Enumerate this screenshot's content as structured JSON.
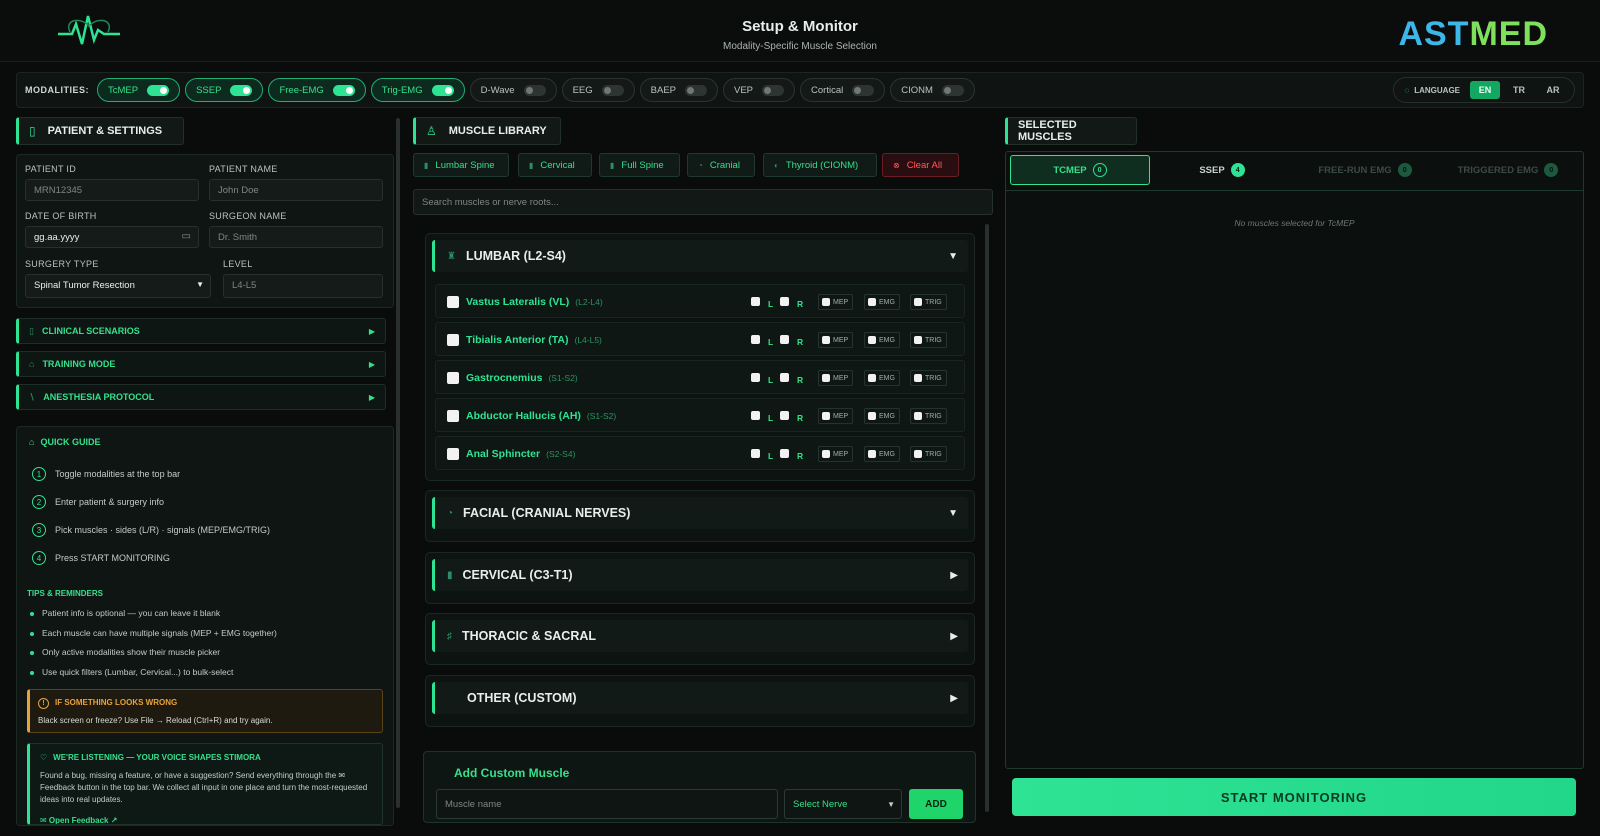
{
  "header": {
    "title": "Setup & Monitor",
    "subtitle": "Modality-Specific Muscle Selection",
    "brand_a": "AST",
    "brand_b": "MED"
  },
  "modalities": {
    "label": "MODALITIES:",
    "items": [
      {
        "label": "TcMEP",
        "on": true
      },
      {
        "label": "SSEP",
        "on": true
      },
      {
        "label": "Free-EMG",
        "on": true
      },
      {
        "label": "Trig-EMG",
        "on": true
      },
      {
        "label": "D-Wave",
        "on": false
      },
      {
        "label": "EEG",
        "on": false
      },
      {
        "label": "BAEP",
        "on": false
      },
      {
        "label": "VEP",
        "on": false
      },
      {
        "label": "Cortical",
        "on": false
      },
      {
        "label": "CIONM",
        "on": false
      }
    ]
  },
  "language": {
    "label": "LANGUAGE",
    "options": [
      "EN",
      "TR",
      "AR"
    ],
    "active": "EN"
  },
  "patient": {
    "title": "PATIENT & SETTINGS",
    "patient_id_label": "PATIENT ID",
    "patient_id_placeholder": "MRN12345",
    "patient_name_label": "PATIENT NAME",
    "patient_name_placeholder": "John Doe",
    "dob_label": "DATE OF BIRTH",
    "dob_value": "gg.aa.yyyy",
    "surgeon_label": "SURGEON NAME",
    "surgeon_placeholder": "Dr. Smith",
    "surgery_type_label": "SURGERY TYPE",
    "surgery_type_value": "Spinal Tumor Resection",
    "level_label": "LEVEL",
    "level_placeholder": "L4-L5"
  },
  "accordions": [
    "CLINICAL SCENARIOS",
    "TRAINING MODE",
    "ANESTHESIA PROTOCOL"
  ],
  "guide": {
    "title": "QUICK GUIDE",
    "steps": [
      "Toggle modalities at the top bar",
      "Enter patient & surgery info",
      "Pick muscles · sides (L/R) · signals (MEP/EMG/TRIG)",
      "Press START MONITORING"
    ],
    "tips_title": "TIPS & REMINDERS",
    "tips": [
      "Patient info is optional — you can leave it blank",
      "Each muscle can have multiple signals (MEP + EMG together)",
      "Only active modalities show their muscle picker",
      "Use quick filters (Lumbar, Cervical...) to bulk-select"
    ],
    "warn_title": "IF SOMETHING LOOKS WRONG",
    "warn_text": "Black screen or freeze? Use File → Reload (Ctrl+R) and try again.",
    "feedback_title": "WE'RE LISTENING — YOUR VOICE SHAPES STIMORA",
    "feedback_text": "Found a bug, missing a feature, or have a suggestion? Send everything through the ✉ Feedback button in the top bar. We collect all input in one place and turn the most-requested ideas into real updates.",
    "feedback_link": "✉ Open Feedback ↗"
  },
  "library": {
    "title": "MUSCLE LIBRARY",
    "filters": [
      "Lumbar Spine",
      "Cervical",
      "Full Spine",
      "Cranial",
      "Thyroid (CIONM)"
    ],
    "clear_label": "Clear All",
    "search_placeholder": "Search muscles or nerve roots...",
    "groups": [
      "LUMBAR (L2-S4)",
      "FACIAL (CRANIAL NERVES)",
      "CERVICAL (C3-T1)",
      "THORACIC & SACRAL",
      "OTHER (CUSTOM)"
    ],
    "muscles": [
      {
        "name": "Vastus Lateralis (VL)",
        "root": "(L2-L4)"
      },
      {
        "name": "Tibialis Anterior (TA)",
        "root": "(L4-L5)"
      },
      {
        "name": "Gastrocnemius",
        "root": "(S1-S2)"
      },
      {
        "name": "Abductor Hallucis (AH)",
        "root": "(S1-S2)"
      },
      {
        "name": "Anal Sphincter",
        "root": "(S2-S4)"
      }
    ],
    "side_l": "L",
    "side_r": "R",
    "sig_mep": "MEP",
    "sig_emg": "EMG",
    "sig_trig": "TRIG",
    "custom_title": "Add Custom Muscle",
    "custom_placeholder": "Muscle name",
    "nerve_select": "Select Nerve",
    "add_label": "ADD"
  },
  "selected": {
    "title": "SELECTED MUSCLES",
    "tabs": [
      {
        "label": "TCMEP",
        "count": "0"
      },
      {
        "label": "SSEP",
        "count": "4"
      },
      {
        "label": "FREE-RUN EMG",
        "count": "0"
      },
      {
        "label": "TRIGGERED EMG",
        "count": "0"
      }
    ],
    "empty": "No muscles selected for TcMEP",
    "start_label": "START MONITORING"
  },
  "colors": {
    "accent": "#2ee394",
    "bg": "#0a0c0b",
    "danger": "#ff5b5b",
    "warn": "#e8a23a"
  }
}
